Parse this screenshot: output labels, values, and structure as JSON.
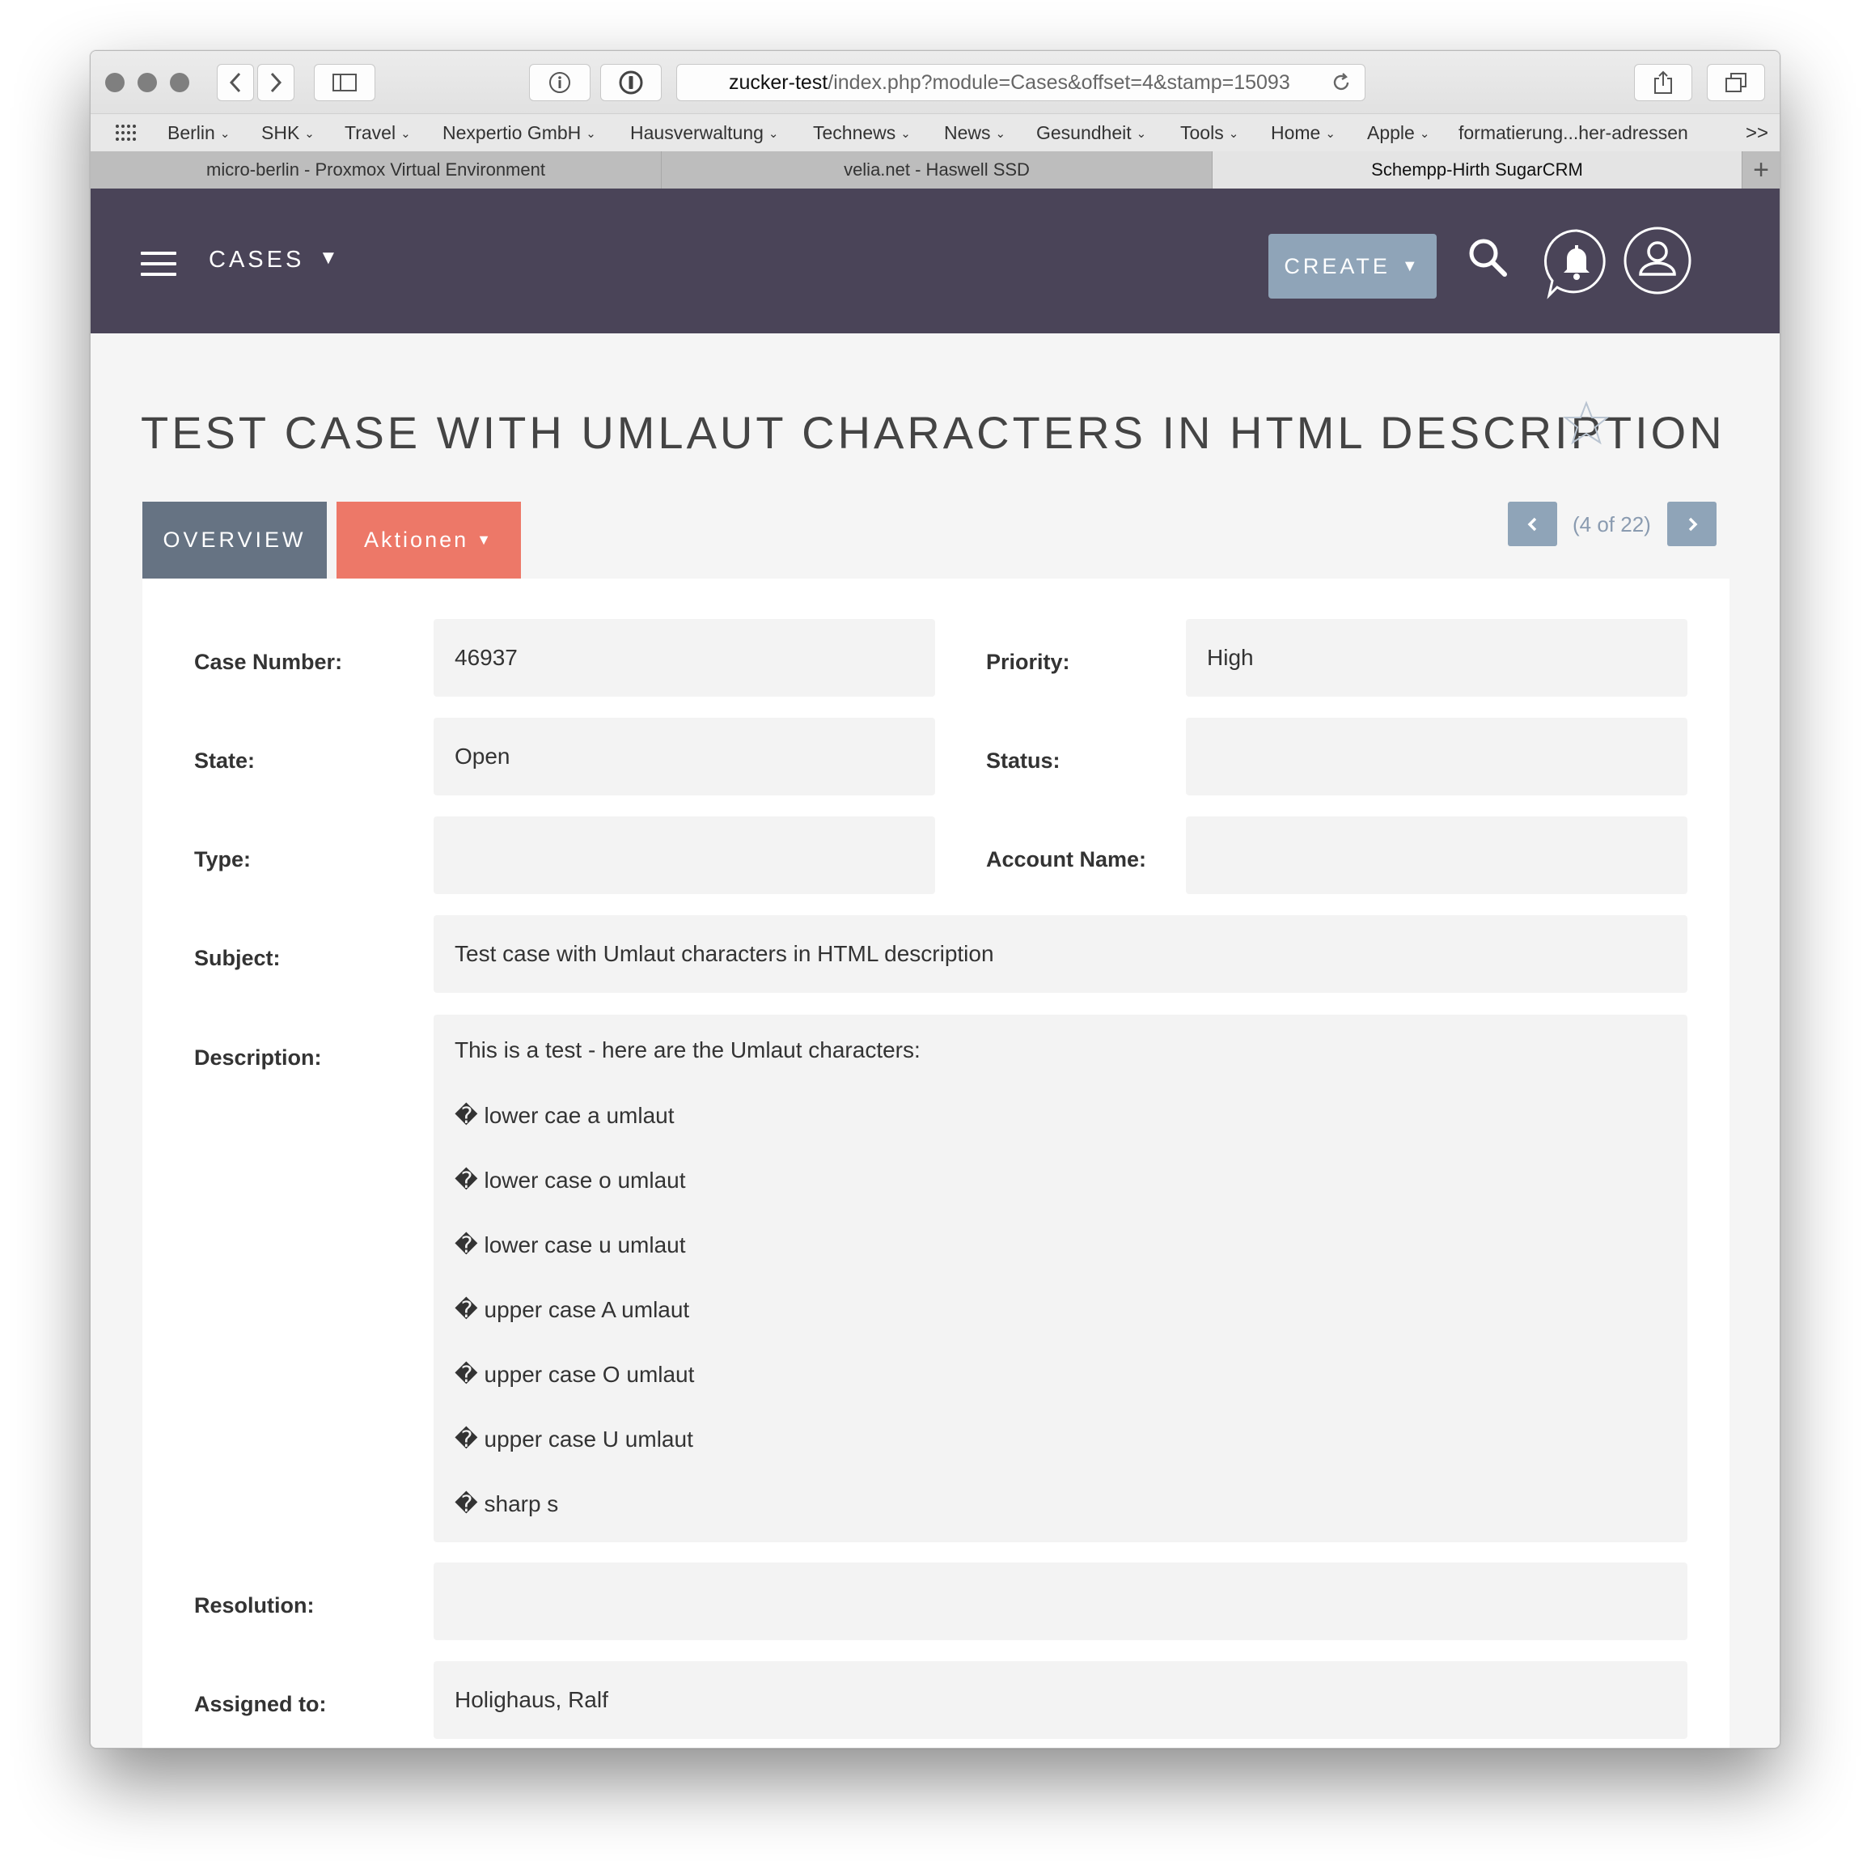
{
  "browser": {
    "url_host": "zucker-test",
    "url_path": "/index.php?module=Cases&offset=4&stamp=15093",
    "bookmarks": [
      {
        "label": "Berlin",
        "has_menu": true
      },
      {
        "label": "SHK",
        "has_menu": true
      },
      {
        "label": "Travel",
        "has_menu": true
      },
      {
        "label": "Nexpertio GmbH",
        "has_menu": true
      },
      {
        "label": "Hausverwaltung",
        "has_menu": true
      },
      {
        "label": "Technews",
        "has_menu": true
      },
      {
        "label": "News",
        "has_menu": true
      },
      {
        "label": "Gesundheit",
        "has_menu": true
      },
      {
        "label": "Tools",
        "has_menu": true
      },
      {
        "label": "Home",
        "has_menu": true
      },
      {
        "label": "Apple",
        "has_menu": true
      },
      {
        "label": "formatierung...her-adressen",
        "has_menu": false
      }
    ],
    "bookmarks_overflow": ">>",
    "tabs": [
      {
        "label": "micro-berlin - Proxmox Virtual Environment",
        "active": false
      },
      {
        "label": "velia.net - Haswell SSD",
        "active": false
      },
      {
        "label": "Schempp-Hirth SugarCRM",
        "active": true
      }
    ],
    "new_tab": "+"
  },
  "header": {
    "module": "CASES",
    "module_arrow": "▼",
    "create_label": "CREATE",
    "create_arrow": "▼"
  },
  "record": {
    "title": "TEST CASE WITH UMLAUT CHARACTERS IN HTML DESCRIPTION",
    "tab_overview": "OVERVIEW",
    "tab_actions": "Aktionen",
    "tab_actions_arrow": "▼",
    "pager_text": "(4 of 22)",
    "fields": {
      "case_number_label": "Case Number:",
      "case_number": "46937",
      "priority_label": "Priority:",
      "priority": "High",
      "state_label": "State:",
      "state": "Open",
      "status_label": "Status:",
      "status": "",
      "type_label": "Type:",
      "type": "",
      "account_name_label": "Account Name:",
      "account_name": "",
      "subject_label": "Subject:",
      "subject": "Test case with Umlaut characters in HTML description",
      "description_label": "Description:",
      "description_lines": [
        "This is a test - here are the Umlaut characters:",
        "� lower cae a umlaut",
        "� lower case o umlaut",
        "� lower case u umlaut",
        "� upper case A umlaut",
        "� upper case O umlaut",
        "� upper case U umlaut",
        "� sharp s"
      ],
      "resolution_label": "Resolution:",
      "resolution": "",
      "assigned_to_label": "Assigned to:",
      "assigned_to": "Holighaus, Ralf"
    }
  },
  "colors": {
    "appbar": "#4a4458",
    "create_button": "#8fa4b8",
    "overview_tab": "#667383",
    "actions_tab": "#ed7868",
    "field_bg": "#f3f3f3"
  }
}
